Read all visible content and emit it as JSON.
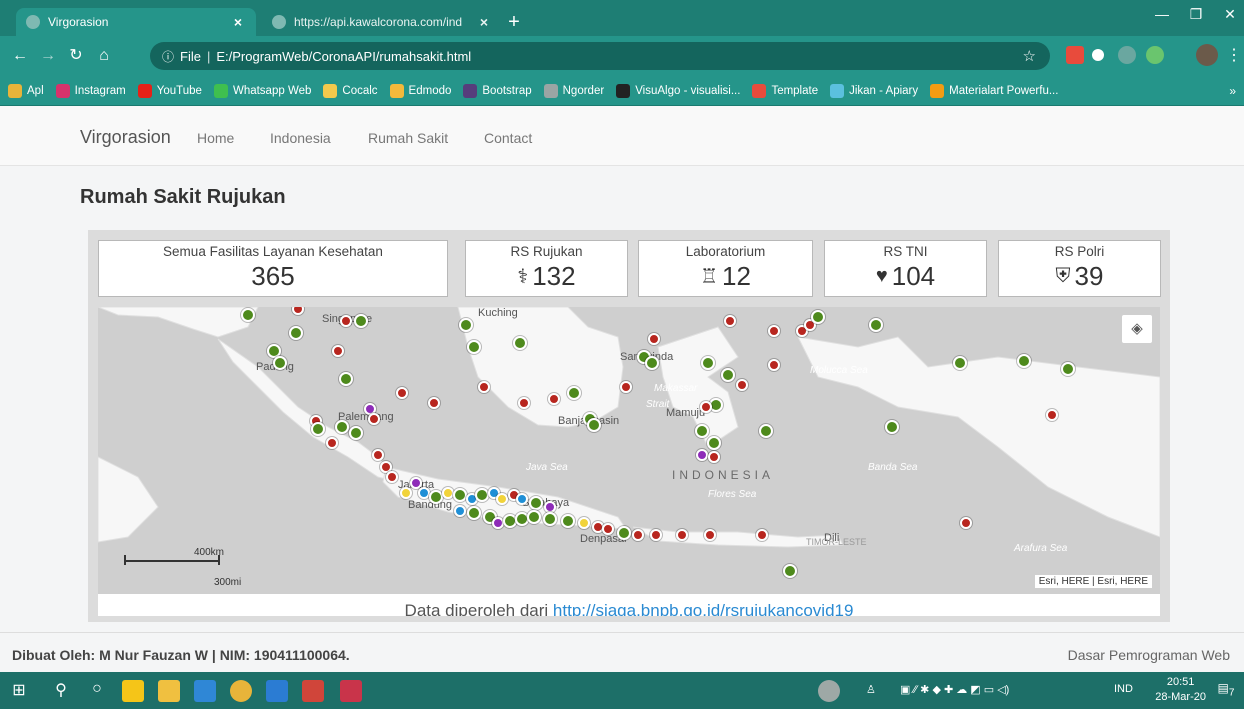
{
  "browser": {
    "tabs": [
      {
        "title": "Virgorasion",
        "active": true
      },
      {
        "title": "https://api.kawalcorona.com/ind",
        "active": false
      }
    ],
    "address": {
      "scheme_label": "File",
      "path": "E:/ProgramWeb/CoronaAPI/rumahsakit.html"
    },
    "bookmarks": [
      {
        "label": "Apl",
        "icon": "apps-icon",
        "color": "#e8b43a"
      },
      {
        "label": "Instagram",
        "icon": "instagram-icon",
        "color": "#d6336c"
      },
      {
        "label": "YouTube",
        "icon": "youtube-icon",
        "color": "#e62117"
      },
      {
        "label": "Whatsapp Web",
        "icon": "whatsapp-icon",
        "color": "#3fbf4f"
      },
      {
        "label": "Cocalc",
        "icon": "cocalc-icon",
        "color": "#f2c94c"
      },
      {
        "label": "Edmodo",
        "icon": "edmodo-icon",
        "color": "#f3b93b"
      },
      {
        "label": "Bootstrap",
        "icon": "bootstrap-icon",
        "color": "#563d7c"
      },
      {
        "label": "Ngorder",
        "icon": "globe-icon",
        "color": "#9aa5a4"
      },
      {
        "label": "VisuAlgo - visualisi...",
        "icon": "visualgo-icon",
        "color": "#222222"
      },
      {
        "label": "Template",
        "icon": "template-icon",
        "color": "#e84b3c"
      },
      {
        "label": "Jikan - Apiary",
        "icon": "jikan-icon",
        "color": "#5bc0de"
      },
      {
        "label": "Materialart Powerfu...",
        "icon": "materialart-icon",
        "color": "#f39c12"
      }
    ]
  },
  "site": {
    "brand": "Virgorasion",
    "nav": [
      "Home",
      "Indonesia",
      "Rumah Sakit",
      "Contact"
    ],
    "heading": "Rumah Sakit Rujukan"
  },
  "stats": [
    {
      "label": "Semua Fasilitas Layanan Kesehatan",
      "value": "365",
      "icon": ""
    },
    {
      "label": "RS Rujukan",
      "value": "132",
      "icon": "hospital-icon",
      "glyph": "⚕"
    },
    {
      "label": "Laboratorium",
      "value": "12",
      "icon": "microscope-icon",
      "glyph": "♖"
    },
    {
      "label": "RS TNI",
      "value": "104",
      "icon": "shield-heart-icon",
      "glyph": "♥"
    },
    {
      "label": "RS Polri",
      "value": "39",
      "icon": "police-shield-icon",
      "glyph": "⛨"
    }
  ],
  "map": {
    "labels": {
      "singapore": "Singapore",
      "kuching": "Kuching",
      "padang": "Padang",
      "palembang": "Palembang",
      "samarinda": "Samarinda",
      "makassar": "Makassar",
      "banjarmasin": "Banjarmasin",
      "mamuju": "Mamuju",
      "jakarta": "Jakarta",
      "bandung": "Bandung",
      "surabaya": "Surabaya",
      "denpasar": "Denpasar",
      "dili": "Dili",
      "timor_leste": "TIMOR-LESTE",
      "indonesia": "INDONESIA",
      "java_sea": "Java Sea",
      "flores_sea": "Flores Sea",
      "banda_sea": "Banda Sea",
      "molucca_sea": "Molucca Sea",
      "arafura_sea": "Arafura Sea",
      "strait": "Strait"
    },
    "scale": {
      "km": "400km",
      "mi": "300mi"
    },
    "attribution": "Esri, HERE | Esri, HERE",
    "marker_colors": {
      "rujukan": "#b8261f",
      "tni": "#4e8a1c",
      "polri": "#1f8fd6",
      "lab": "#8e2cb8",
      "other": "#f1d33a"
    }
  },
  "source": {
    "text": "Data diperoleh dari ",
    "link": "http://siaga.bnpb.go.id/rsrujukancovid19"
  },
  "footer": {
    "left": "Dibuat Oleh: M Nur Fauzan W | NIM: 190411100064.",
    "right": "Dasar Pemrograman Web"
  },
  "taskbar": {
    "language": "IND",
    "time": "20:51",
    "date": "28-Mar-20",
    "notifications": "7"
  }
}
